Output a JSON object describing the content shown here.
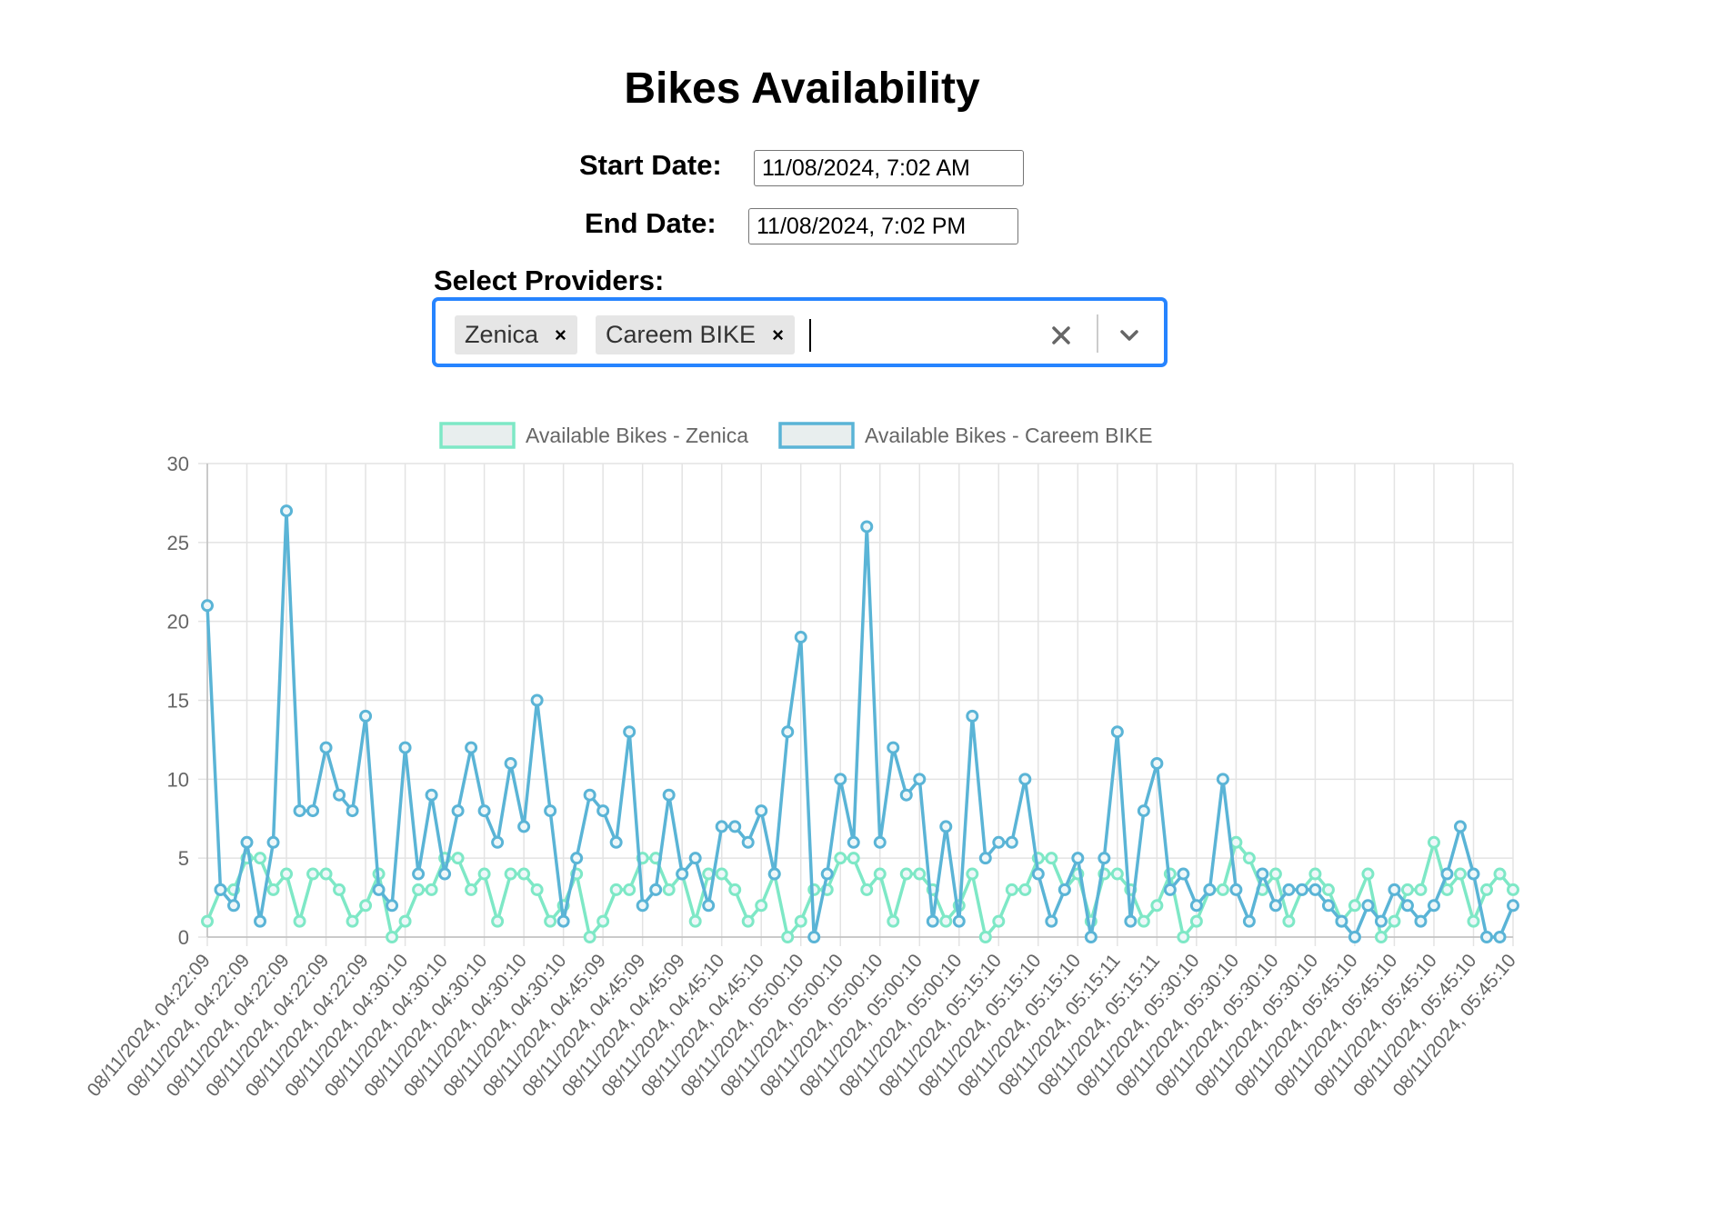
{
  "page": {
    "title": "Bikes Availability"
  },
  "filters": {
    "start_label": "Start Date:",
    "start_value": "11/08/2024, 7:02 AM",
    "end_label": "End Date:",
    "end_value": "11/08/2024, 7:02 PM",
    "providers_label": "Select Providers:",
    "selected": [
      "Zenica",
      "Careem BIKE"
    ],
    "remove_glyph": "×",
    "clear_icon": "close-icon",
    "dropdown_icon": "chevron-down-icon"
  },
  "chart_data": {
    "type": "line",
    "title": "",
    "xlabel": "",
    "ylabel": "",
    "ylim": [
      0,
      30
    ],
    "yticks": [
      0,
      5,
      10,
      15,
      20,
      25,
      30
    ],
    "grid": true,
    "legend": "top-center",
    "x_tick_labels": [
      "08/11/2024, 04:22:09",
      "08/11/2024, 04:22:09",
      "08/11/2024, 04:22:09",
      "08/11/2024, 04:22:09",
      "08/11/2024, 04:22:09",
      "08/11/2024, 04:30:10",
      "08/11/2024, 04:30:10",
      "08/11/2024, 04:30:10",
      "08/11/2024, 04:30:10",
      "08/11/2024, 04:30:10",
      "08/11/2024, 04:45:09",
      "08/11/2024, 04:45:09",
      "08/11/2024, 04:45:09",
      "08/11/2024, 04:45:10",
      "08/11/2024, 04:45:10",
      "08/11/2024, 05:00:10",
      "08/11/2024, 05:00:10",
      "08/11/2024, 05:00:10",
      "08/11/2024, 05:00:10",
      "08/11/2024, 05:00:10",
      "08/11/2024, 05:15:10",
      "08/11/2024, 05:15:10",
      "08/11/2024, 05:15:10",
      "08/11/2024, 05:15:11",
      "08/11/2024, 05:15:11",
      "08/11/2024, 05:30:10",
      "08/11/2024, 05:30:10",
      "08/11/2024, 05:30:10",
      "08/11/2024, 05:30:10",
      "08/11/2024, 05:45:10",
      "08/11/2024, 05:45:10",
      "08/11/2024, 05:45:10",
      "08/11/2024, 05:45:10",
      "08/11/2024, 05:45:10"
    ],
    "point_count": 100,
    "series": [
      {
        "name": "Available Bikes - Zenica",
        "color": "#7ee8c6",
        "values": [
          1,
          3,
          3,
          5,
          5,
          3,
          4,
          1,
          4,
          4,
          3,
          1,
          2,
          4,
          0,
          1,
          3,
          3,
          5,
          5,
          3,
          4,
          1,
          4,
          4,
          3,
          1,
          2,
          4,
          0,
          1,
          3,
          3,
          5,
          5,
          3,
          4,
          1,
          4,
          4,
          3,
          1,
          2,
          4,
          0,
          1,
          3,
          3,
          5,
          5,
          3,
          4,
          1,
          4,
          4,
          3,
          1,
          2,
          4,
          0,
          1,
          3,
          3,
          5,
          5,
          3,
          4,
          1,
          4,
          4,
          3,
          1,
          2,
          4,
          0,
          1,
          3,
          3,
          6,
          5,
          3,
          4,
          1,
          3,
          4,
          3,
          1,
          2,
          4,
          0,
          1,
          3,
          3,
          6,
          3,
          4,
          1,
          3,
          4,
          3
        ]
      },
      {
        "name": "Available Bikes - Careem BIKE",
        "color": "#5ab4d6",
        "values": [
          21,
          3,
          2,
          6,
          1,
          6,
          27,
          8,
          8,
          12,
          9,
          8,
          14,
          3,
          2,
          12,
          4,
          9,
          4,
          8,
          12,
          8,
          6,
          11,
          7,
          15,
          8,
          1,
          5,
          9,
          8,
          6,
          13,
          2,
          3,
          9,
          4,
          5,
          2,
          7,
          7,
          6,
          8,
          4,
          13,
          19,
          0,
          4,
          10,
          6,
          26,
          6,
          12,
          9,
          10,
          1,
          7,
          1,
          14,
          5,
          6,
          6,
          10,
          4,
          1,
          3,
          5,
          0,
          5,
          13,
          1,
          8,
          11,
          3,
          4,
          2,
          3,
          10,
          3,
          1,
          4,
          2,
          3,
          3,
          3,
          2,
          1,
          0,
          2,
          1,
          3,
          2,
          1,
          2,
          4,
          7,
          4,
          0,
          0,
          2
        ]
      }
    ]
  }
}
